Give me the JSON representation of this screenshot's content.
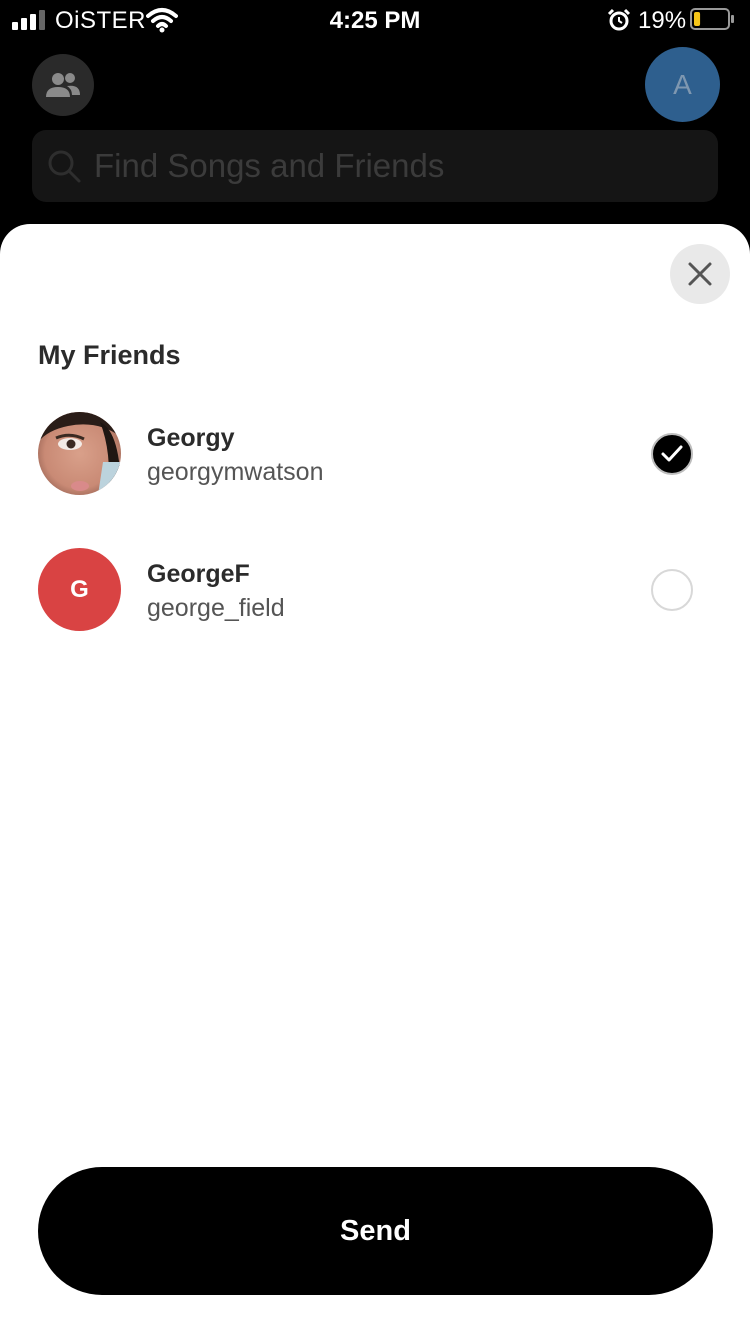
{
  "status_bar": {
    "carrier": "OiSTER",
    "time": "4:25 PM",
    "battery_percent": "19%",
    "battery_level": 0.19,
    "battery_color": "#f5c518",
    "icons": [
      "signal-icon",
      "wifi-icon",
      "alarm-icon",
      "battery-icon"
    ]
  },
  "header": {
    "friends_icon": "people-icon",
    "profile_initial": "A",
    "profile_color": "#2e5f8e"
  },
  "search": {
    "placeholder": "Find Songs and Friends",
    "value": ""
  },
  "sheet": {
    "close_icon": "close-icon",
    "section_title": "My Friends",
    "friends": [
      {
        "name": "Georgy",
        "handle": "georgymwatson",
        "avatar": "photo",
        "selected": true
      },
      {
        "name": "GeorgeF",
        "handle": "george_field",
        "avatar_initial": "G",
        "avatar_color": "#d94343",
        "selected": false
      }
    ],
    "send_label": "Send"
  }
}
